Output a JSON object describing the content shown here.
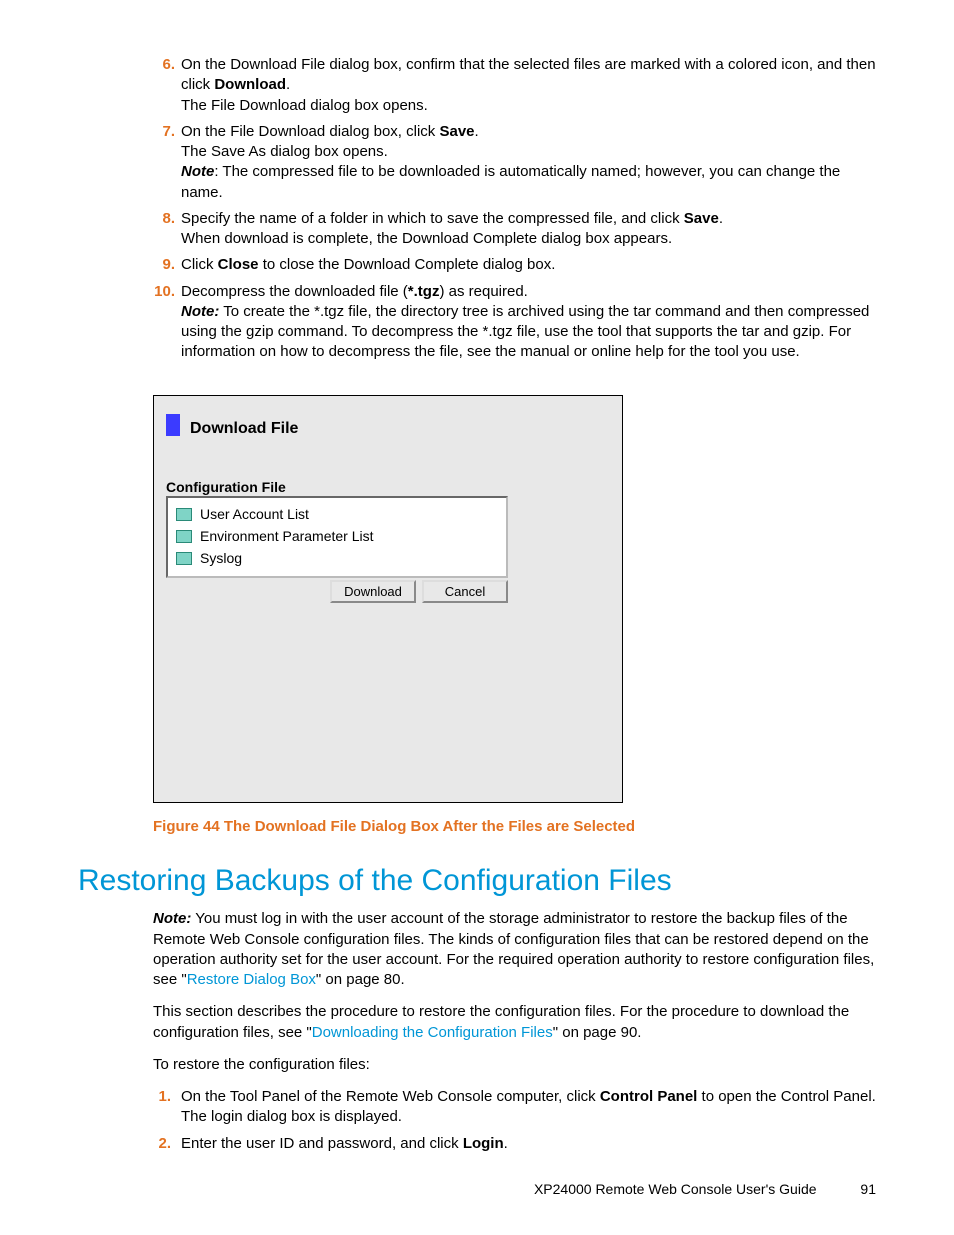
{
  "steps_top": {
    "6": {
      "num": "6.",
      "l1a": "On the Download File dialog box, confirm that the selected files are marked with a colored icon, and then click ",
      "l1b": "Download",
      "l1c": ".",
      "l2": "The File Download dialog box opens."
    },
    "7": {
      "num": "7.",
      "l1a": "On the File Download dialog box, click ",
      "l1b": "Save",
      "l1c": ".",
      "l2": "The Save As dialog box opens.",
      "l3a": "Note",
      "l3b": ": The compressed file to be downloaded is automatically named; however, you can change the name."
    },
    "8": {
      "num": "8.",
      "l1a": "Specify the name of a folder in which to save the compressed file, and click ",
      "l1b": "Save",
      "l1c": ".",
      "l2": "When download is complete, the Download Complete dialog box appears."
    },
    "9": {
      "num": "9.",
      "l1a": "Click ",
      "l1b": "Close",
      "l1c": " to close the Download Complete dialog box."
    },
    "10": {
      "num": "10.",
      "l1a": "Decompress the downloaded file (",
      "l1b": "*.tgz",
      "l1c": ") as required.",
      "l2a": "Note:",
      "l2b": " To create the *.tgz file, the directory tree is archived using the tar command and then compressed using the gzip command. To decompress the *.tgz file, use the tool that supports the tar and gzip. For information on how to decompress the file, see the manual or online help for the tool you use."
    }
  },
  "dialog": {
    "title": "Download File",
    "section": "Configuration File",
    "items": [
      "User Account List",
      "Environment Parameter List",
      "Syslog"
    ],
    "btn_download": "Download",
    "btn_cancel": "Cancel"
  },
  "figure_caption": "Figure 44 The Download File Dialog Box After the Files are Selected",
  "h1": "Restoring Backups of the Configuration Files",
  "para1": {
    "a": "Note:",
    "b": " You must log in with the user account of the storage administrator to restore the backup files of the Remote Web Console configuration files. The kinds of configuration files that can be restored depend on the operation authority set for the user account. For the required operation authority to restore configuration files, see \"",
    "link": "Restore Dialog Box",
    "c": "\" on page 80."
  },
  "para2": {
    "a": "This section describes the procedure to restore the configuration files. For the procedure to download the configuration files, see \"",
    "link": "Downloading the Configuration Files",
    "b": "\" on page 90."
  },
  "para3": "To restore the configuration files:",
  "steps_bottom": {
    "1": {
      "num": "1.",
      "l1a": "On the Tool Panel of the Remote Web Console computer, click ",
      "l1b": "Control Panel",
      "l1c": " to open the Control Panel.",
      "l2": "The login dialog box is displayed."
    },
    "2": {
      "num": "2.",
      "l1a": "Enter the user ID and password, and click ",
      "l1b": "Login",
      "l1c": "."
    }
  },
  "footer": {
    "title": "XP24000 Remote Web Console User's Guide",
    "page": "91"
  }
}
